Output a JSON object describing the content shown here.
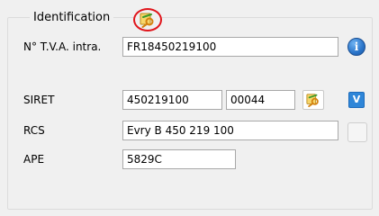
{
  "group": {
    "title": "Identification",
    "edit_icon": "key-edit-icon"
  },
  "vat": {
    "label": "N° T.V.A. intra.",
    "value": "FR18450219100",
    "info_icon": "info-icon"
  },
  "siret": {
    "label": "SIRET",
    "siren_value": "450219100",
    "nic_value": "00044",
    "edit_icon": "key-edit-icon",
    "validate_label": "V"
  },
  "rcs": {
    "label": "RCS",
    "value": "Evry B 450 219 100"
  },
  "ape": {
    "label": "APE",
    "value": "5829C"
  },
  "colors": {
    "highlight": "#e0151b",
    "accent": "#2f86d8"
  }
}
